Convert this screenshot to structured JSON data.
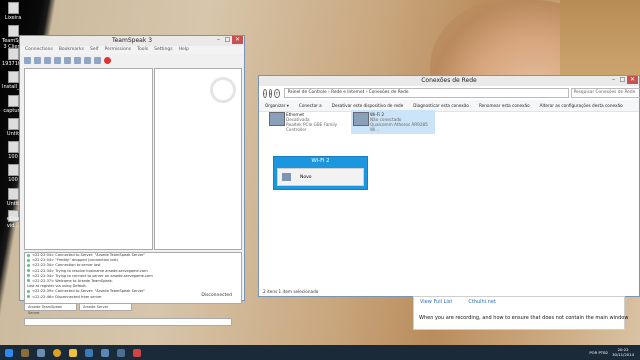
{
  "desktop": {
    "icons": [
      "Lixeira",
      "TeamSpeak 3 Client",
      "193710851_...",
      "Install_Vi...",
      "captura",
      "Untit",
      "100",
      "100",
      "Untit",
      "vid...",
      "eCoa"
    ]
  },
  "teamspeak": {
    "title": "TeamSpeak 3",
    "menu": [
      "Connections",
      "Bookmarks",
      "Self",
      "Permissions",
      "Tools",
      "Settings",
      "Help"
    ],
    "chat_lines": [
      "<22:22:04> Connected to Server: \"Arsede TeamSpeak Server\"",
      "<22:22:04> \"Freddy\" dropped (connection lost)",
      "<22:22:34> Connection to server lost",
      "<22:22:34> Trying to resolve hostname arsede.servegame.com",
      "<22:22:34> Trying to connect to server on arsede.servegame.com",
      "<22:22:37> Welcome to Arsede TeamSpeak.",
      "Lost at register via using Default.",
      "<22:22:39> Connected to Server: \"Arsede TeamSpeak Server\"",
      "<22:22:46> Disconnected from server"
    ],
    "tabs": [
      "Arsede TeamSpeak Server",
      "Arsede Server"
    ],
    "status": "Disconnected"
  },
  "network": {
    "title": "Conexões de Rede",
    "path": "Painel de Controle  ›  Rede e Internet  ›  Conexões de Rede",
    "search_placeholder": "Pesquisar Conexões de Rede",
    "commands": [
      "Organizar ▾",
      "Conectar a",
      "Desativar este dispositivo de rede",
      "Diagnosticar esta conexão",
      "Renomear esta conexão",
      "Alterar as configurações desta conexão"
    ],
    "adapters": [
      {
        "name": "Ethernet",
        "state": "Desativada",
        "device": "Realtek PCIe GBE Family Controller"
      },
      {
        "name": "Wi-Fi 2",
        "state": "Não conectado",
        "device": "Qualcomm Atheros AR9285 Wi..."
      }
    ],
    "status": "2 itens     1 item selecionado"
  },
  "wifi_popup": {
    "header": "Wi-Fi 2",
    "item": "Novo"
  },
  "tip": {
    "tabs": [
      "View Full List",
      "Cthulhi.net"
    ],
    "text": "When you are recording, and how to ensure that does not contain the main window"
  },
  "taskbar": {
    "lang": "POR PTB2",
    "time": "20:22",
    "date": "30/11/2014"
  }
}
